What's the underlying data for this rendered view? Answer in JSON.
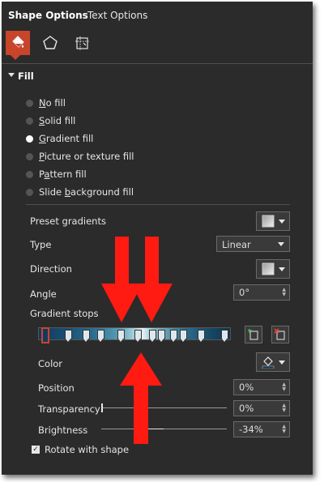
{
  "tabs": {
    "shape_options": "Shape Options",
    "text_options": "Text Options"
  },
  "icons": {
    "fill_line": "paint-bucket-icon",
    "effects": "pentagon-icon",
    "size_properties": "size-properties-icon"
  },
  "section": {
    "title": "Fill"
  },
  "fill_options": [
    {
      "label": "No fill",
      "checked": false
    },
    {
      "label": "Solid fill",
      "checked": false
    },
    {
      "label": "Gradient fill",
      "checked": true
    },
    {
      "label": "Picture or texture fill",
      "checked": false
    },
    {
      "label": "Pattern fill",
      "checked": false
    },
    {
      "label": "Slide background fill",
      "checked": false
    }
  ],
  "preset_gradients": {
    "label": "Preset gradients"
  },
  "type": {
    "label": "Type",
    "value": "Linear"
  },
  "direction": {
    "label": "Direction"
  },
  "angle": {
    "label": "Angle",
    "value": "0°"
  },
  "gradient_stops": {
    "label": "Gradient stops",
    "count": 12
  },
  "color": {
    "label": "Color"
  },
  "position": {
    "label": "Position",
    "value": "0%"
  },
  "transparency": {
    "label": "Transparency",
    "value": "0%",
    "level": 0
  },
  "brightness": {
    "label": "Brightness",
    "value": "-34%",
    "level": -0.34
  },
  "rotate_with_shape": {
    "label": "Rotate with shape",
    "checked": true
  },
  "colors": {
    "accent": "#c8452c",
    "panel": "#2b2b2b",
    "arrow": "#ff1a12"
  }
}
